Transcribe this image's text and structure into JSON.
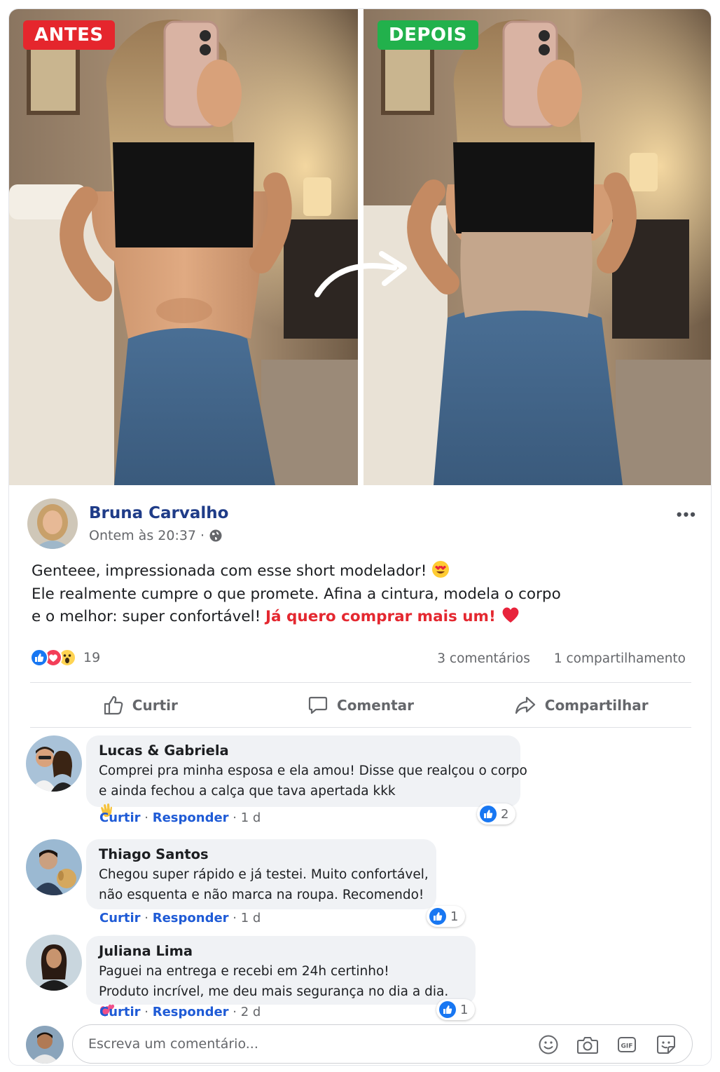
{
  "hero": {
    "before_label": "ANTES",
    "after_label": "DEPOIS"
  },
  "post": {
    "author": "Bruna Carvalho",
    "timestamp": "Ontem às 20:37 ·",
    "text_line1": "Genteee, impressionada com esse short modelador!",
    "text_line2": "Ele realmente cumpre o que promete. Afina a cintura, modela o corpo",
    "text_line3": "e o melhor: super confortável!",
    "text_highlight": "Já quero comprar mais um!",
    "reaction_count": "19",
    "comments_count": "3 comentários",
    "shares_count": "1 compartilhamento",
    "reactions": [
      "like-icon",
      "love-icon",
      "wow-icon"
    ],
    "colors": {
      "author": "#1f3c88",
      "highlight": "#e42830",
      "like": "#1877f2",
      "love": "#f33e58"
    }
  },
  "actions": {
    "like": "Curtir",
    "comment": "Comentar",
    "share": "Compartilhar"
  },
  "comments": [
    {
      "name": "Lucas & Gabriela",
      "line1": "Comprei pra minha esposa e ela amou! Disse que realçou o corpo",
      "line2": "e ainda fechou a calça que tava apertada kkk",
      "like": "Curtir",
      "reply": "Responder",
      "time": "· 1 d",
      "likes": "2"
    },
    {
      "name": "Thiago Santos",
      "line1": "Chegou super rápido e já testei. Muito confortável,",
      "line2": "não esquenta e não marca na roupa. Recomendo!",
      "like": "Curtir",
      "reply": "Responder",
      "time": "· 1 d",
      "likes": "1"
    },
    {
      "name": "Juliana Lima",
      "line1": "Paguei na entrega e recebi em 24h certinho!",
      "line2": "Produto incrível, me deu mais segurança no dia a dia.",
      "like": "Curtir",
      "reply": "Responder",
      "time": "· 2 d",
      "likes": "1"
    }
  ],
  "composer": {
    "placeholder": "Escreva um comentário...",
    "tools": [
      "emoji-icon",
      "camera-icon",
      "gif-icon",
      "sticker-icon"
    ]
  }
}
